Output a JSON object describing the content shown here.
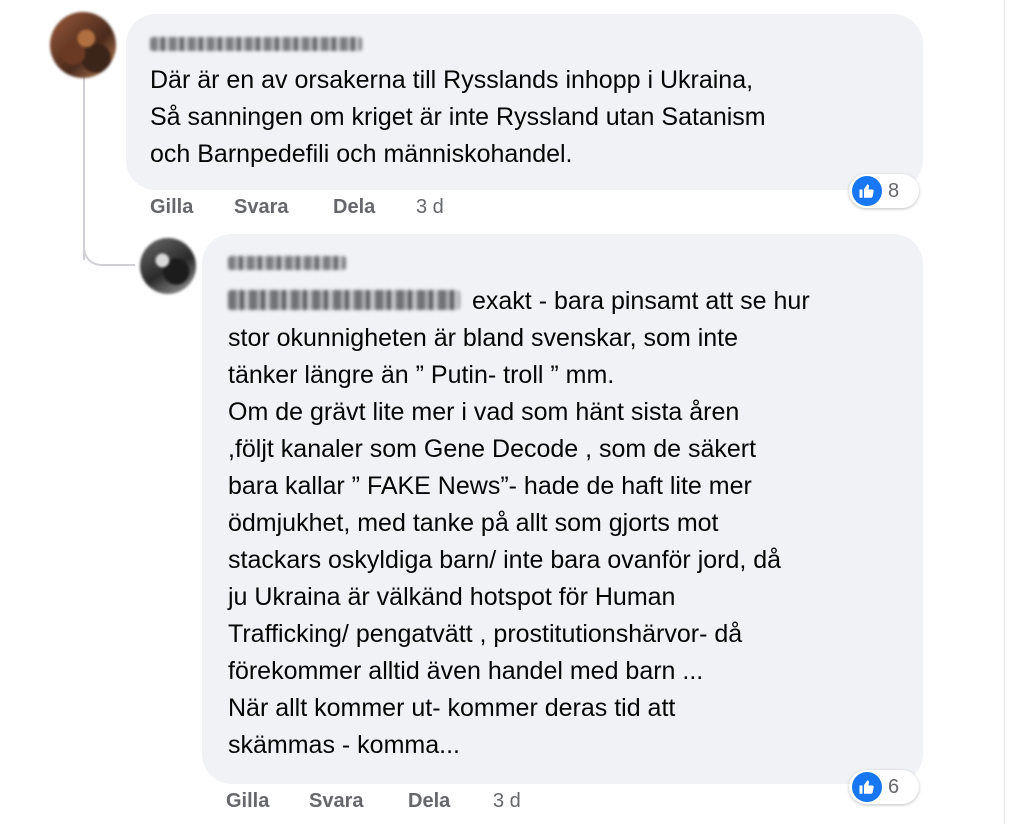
{
  "comments": [
    {
      "author_visible": "blurred",
      "text": "Där är en av orsakerna till Rysslands inhopp i Ukraina,\nSå sanningen om kriget är inte Ryssland utan Satanism\noch Barnpedefili och människohandel.",
      "actions": {
        "like": "Gilla",
        "reply": "Svara",
        "share": "Dela",
        "time": "3 d"
      },
      "reaction": {
        "icon": "like-icon",
        "count": "8",
        "color": "#1877f2"
      }
    },
    {
      "author_visible": "blurred",
      "mention_visible": "blurred",
      "text_first_line": "exakt - bara pinsamt att se hur",
      "text": "stor okunnigheten är bland svenskar, som inte\ntänker längre än ” Putin- troll ” mm.\nOm de grävt lite mer i vad som hänt sista åren\n,följt kanaler som Gene Decode , som de säkert\nbara kallar ” FAKE News”- hade de haft lite mer\nödmjukhet, med tanke på allt som gjorts mot\nstackars oskyldiga barn/ inte bara ovanför jord, då\nju Ukraina är välkänd hotspot för Human\nTrafficking/ pengatvätt , prostitutionshärvor- då\nförekommer alltid även handel med barn ...\nNär allt kommer ut- kommer deras tid att\nskämmas - komma...",
      "actions": {
        "like": "Gilla",
        "reply": "Svara",
        "share": "Dela",
        "time": "3 d"
      },
      "reaction": {
        "icon": "like-icon",
        "count": "6",
        "color": "#1877f2"
      }
    }
  ]
}
